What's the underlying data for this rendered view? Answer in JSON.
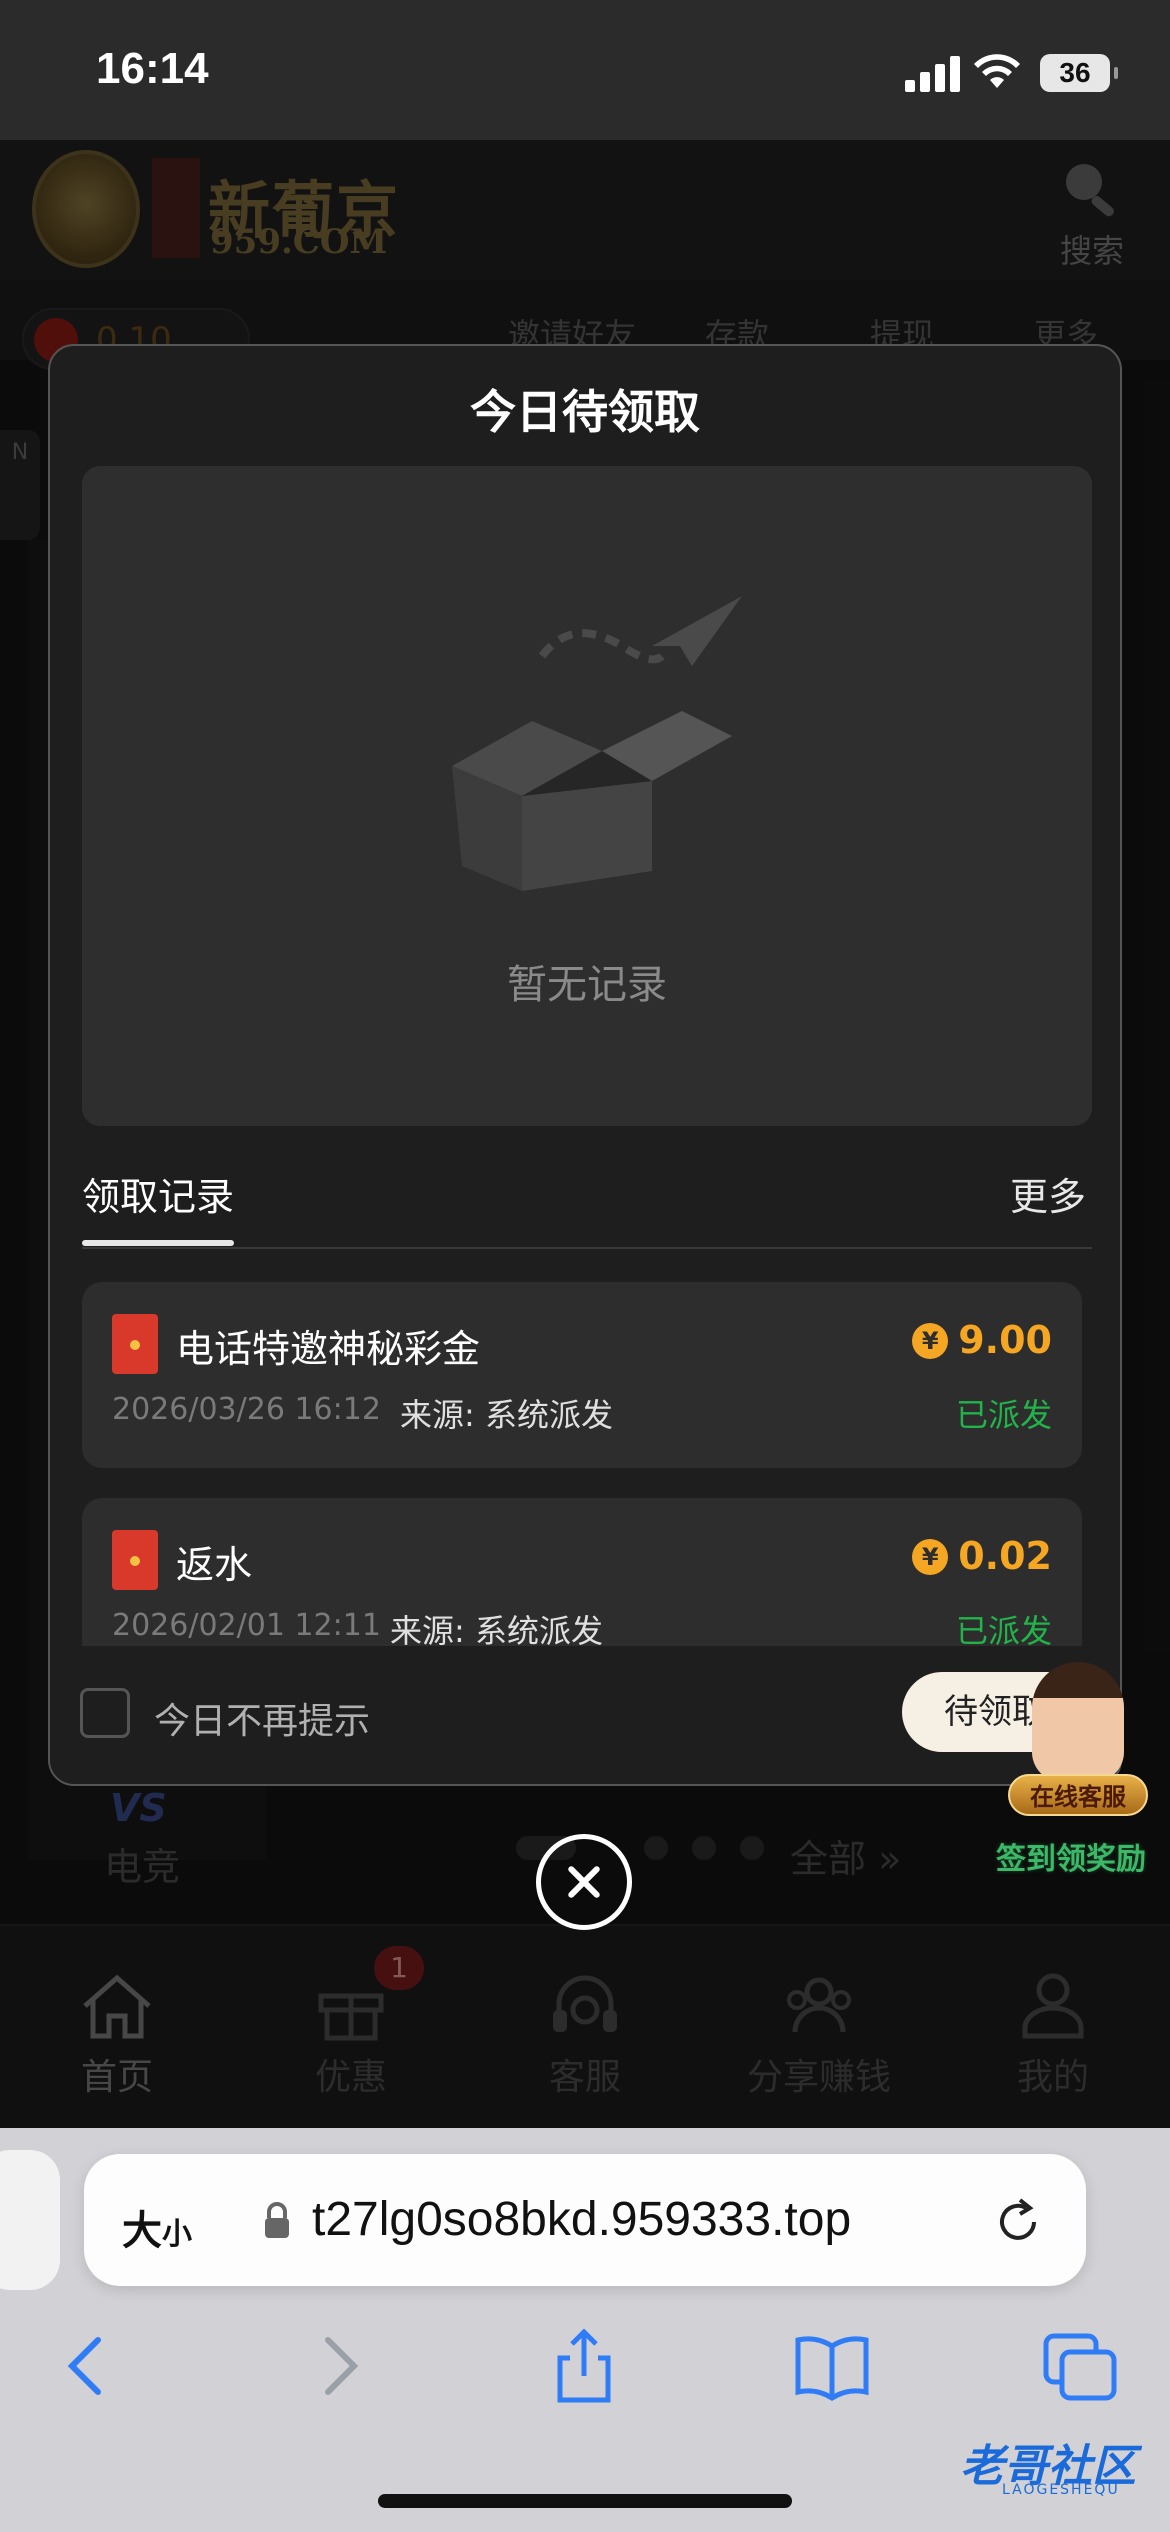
{
  "status_bar": {
    "time": "16:14",
    "battery": "36"
  },
  "site": {
    "logo_main": "新葡京",
    "logo_sub": "959.COM",
    "search_label": "搜索",
    "balance": "0.10",
    "quick_actions": [
      "邀请好友",
      "存款",
      "提现",
      "更多"
    ],
    "side_tab": "N"
  },
  "background": {
    "esports_icon": "VS",
    "esports_label": "电竞",
    "view_all": "全部 »"
  },
  "modal": {
    "title": "今日待领取",
    "empty_text": "暂无记录",
    "tab_active": "领取记录",
    "more": "更多",
    "records": [
      {
        "name": "电话特邀神秘彩金",
        "amount": "9.00",
        "date": "2026/03/26 16:12",
        "source": "来源: 系统派发",
        "status": "已派发"
      },
      {
        "name": "返水",
        "amount": "0.02",
        "date": "2026/02/01 12:11",
        "source": "来源: 系统派发",
        "status": "已派发"
      }
    ],
    "currency_symbol": "¥",
    "no_remind": "今日不再提示",
    "pending_button": "待领取"
  },
  "agent": {
    "label": "在线客服",
    "reward": "签到领奖励"
  },
  "bottom_nav": {
    "items": [
      "首页",
      "优惠",
      "客服",
      "分享赚钱",
      "我的"
    ],
    "promo_badge": "1"
  },
  "browser": {
    "text_size_big": "大",
    "text_size_small": "小",
    "url": "t27lg0so8bkd.959333.top"
  },
  "watermark": {
    "text": "老哥社区",
    "sub": "LAOGESHEQU"
  },
  "colors": {
    "accent_gold": "#f5a623",
    "status_green": "#22b34a",
    "modal_bg": "#1e1e1e",
    "panel_bg": "#2e2e2e"
  }
}
